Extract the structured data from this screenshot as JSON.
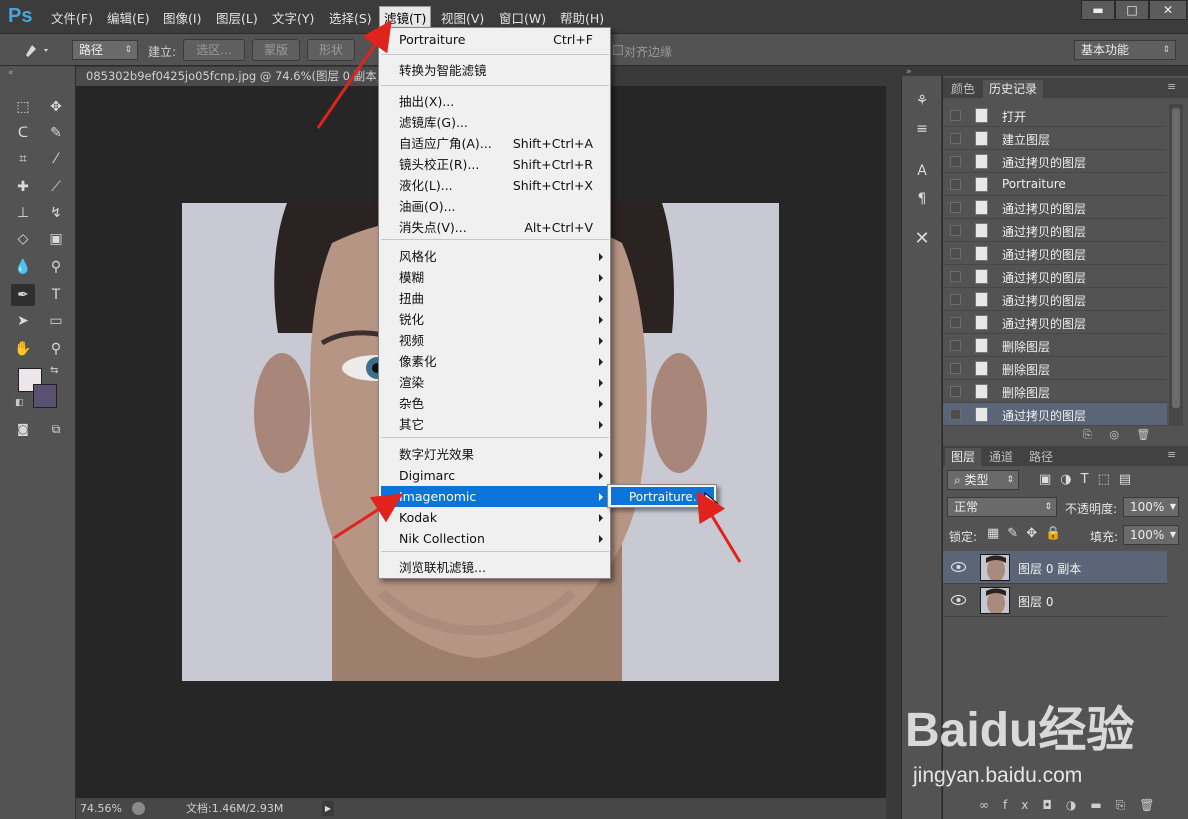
{
  "app": {
    "logo": "Ps"
  },
  "menubar": {
    "items": [
      "文件(F)",
      "编辑(E)",
      "图像(I)",
      "图层(L)",
      "文字(Y)",
      "选择(S)",
      "滤镜(T)",
      "视图(V)",
      "窗口(W)",
      "帮助(H)"
    ],
    "active": "滤镜(T)"
  },
  "window_controls": {
    "minimize": "▬",
    "maximize": "□",
    "close": "✕"
  },
  "options_bar": {
    "mode": "路径",
    "build_label": "建立:",
    "selection_btn": "选区...",
    "mask_btn": "蒙版",
    "shape_btn": "形状",
    "align_edges": "对齐边缘",
    "workspace": "基本功能"
  },
  "document": {
    "tab_title": "085302b9ef0425jo05fcnp.jpg @ 74.6%(图层 0 副本,",
    "zoom": "74.56%",
    "doc_info": "文档:1.46M/2.93M"
  },
  "filter_menu": {
    "last_filter": "Portraiture",
    "last_filter_shortcut": "Ctrl+F",
    "convert_smart": "转换为智能滤镜",
    "group1": [
      {
        "label": "抽出(X)...",
        "shortcut": ""
      },
      {
        "label": "滤镜库(G)...",
        "shortcut": ""
      },
      {
        "label": "自适应广角(A)...",
        "shortcut": "Shift+Ctrl+A"
      },
      {
        "label": "镜头校正(R)...",
        "shortcut": "Shift+Ctrl+R"
      },
      {
        "label": "液化(L)...",
        "shortcut": "Shift+Ctrl+X"
      },
      {
        "label": "油画(O)...",
        "shortcut": ""
      },
      {
        "label": "消失点(V)...",
        "shortcut": "Alt+Ctrl+V"
      }
    ],
    "group2": [
      "风格化",
      "模糊",
      "扭曲",
      "锐化",
      "视频",
      "像素化",
      "渲染",
      "杂色",
      "其它"
    ],
    "group3": [
      "数字灯光效果",
      "Digimarc",
      "Imagenomic",
      "Kodak",
      "Nik Collection"
    ],
    "highlighted": "Imagenomic",
    "browse": "浏览联机滤镜..."
  },
  "submenu": {
    "item": "Portraiture..."
  },
  "history_panel": {
    "tabs": [
      "颜色",
      "历史记录"
    ],
    "active_tab": "历史记录",
    "items": [
      "打开",
      "建立图层",
      "通过拷贝的图层",
      "Portraiture",
      "通过拷贝的图层",
      "通过拷贝的图层",
      "通过拷贝的图层",
      "通过拷贝的图层",
      "通过拷贝的图层",
      "通过拷贝的图层",
      "删除图层",
      "删除图层",
      "删除图层",
      "通过拷贝的图层"
    ],
    "selected_index": 13
  },
  "layers_panel": {
    "tabs": [
      "图层",
      "通道",
      "路径"
    ],
    "active_tab": "图层",
    "filter_kind": "类型",
    "blend_mode": "正常",
    "opacity_label": "不透明度:",
    "opacity": "100%",
    "lock_label": "锁定:",
    "fill_label": "填充:",
    "fill": "100%",
    "layers": [
      "图层 0 副本",
      "图层 0"
    ],
    "selected_index": 0
  },
  "watermark": {
    "brand": "Baidu经验",
    "url": "jingyan.baidu.com"
  },
  "colors": {
    "menu_highlight": "#0a74d8",
    "annotation_arrow": "#e0231c",
    "ps_blue": "#4aa3df"
  }
}
